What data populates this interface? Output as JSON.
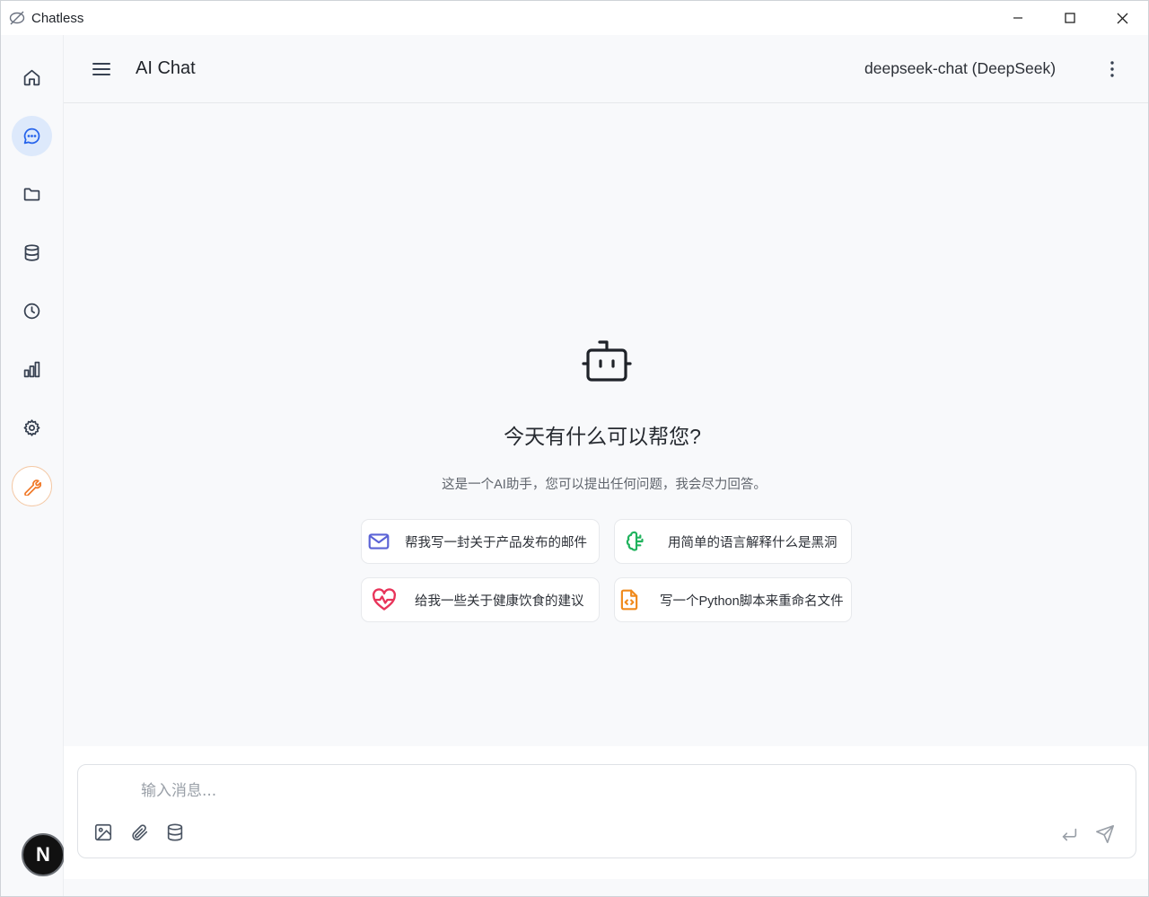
{
  "window": {
    "title": "Chatless"
  },
  "header": {
    "title": "AI Chat",
    "model": "deepseek-chat (DeepSeek)"
  },
  "sidebar": {
    "items": [
      {
        "name": "home",
        "icon": "home-icon",
        "active": false
      },
      {
        "name": "chat",
        "icon": "chat-bubble-icon",
        "active": true
      },
      {
        "name": "files",
        "icon": "folder-icon",
        "active": false
      },
      {
        "name": "knowledge",
        "icon": "database-icon",
        "active": false
      },
      {
        "name": "history",
        "icon": "clock-icon",
        "active": false
      },
      {
        "name": "analytics",
        "icon": "bar-chart-icon",
        "active": false
      },
      {
        "name": "settings",
        "icon": "gear-icon",
        "active": false
      },
      {
        "name": "tools",
        "icon": "wrench-icon",
        "active": false
      }
    ],
    "avatar_letter": "N"
  },
  "welcome": {
    "title": "今天有什么可以帮您?",
    "subtitle": "这是一个AI助手，您可以提出任何问题，我会尽力回答。"
  },
  "suggestions": [
    {
      "label": "帮我写一封关于产品发布的邮件",
      "icon": "mail-icon",
      "color": "#5b63d6"
    },
    {
      "label": "用简单的语言解释什么是黑洞",
      "icon": "brain-icon",
      "color": "#21b35e"
    },
    {
      "label": "给我一些关于健康饮食的建议",
      "icon": "heart-pulse-icon",
      "color": "#e8345a"
    },
    {
      "label": "写一个Python脚本来重命名文件",
      "icon": "code-file-icon",
      "color": "#f08a1c"
    }
  ],
  "composer": {
    "placeholder": "输入消息...",
    "value": ""
  },
  "colors": {
    "accent": "#dde9fb",
    "tools_accent": "#f07a2a"
  }
}
